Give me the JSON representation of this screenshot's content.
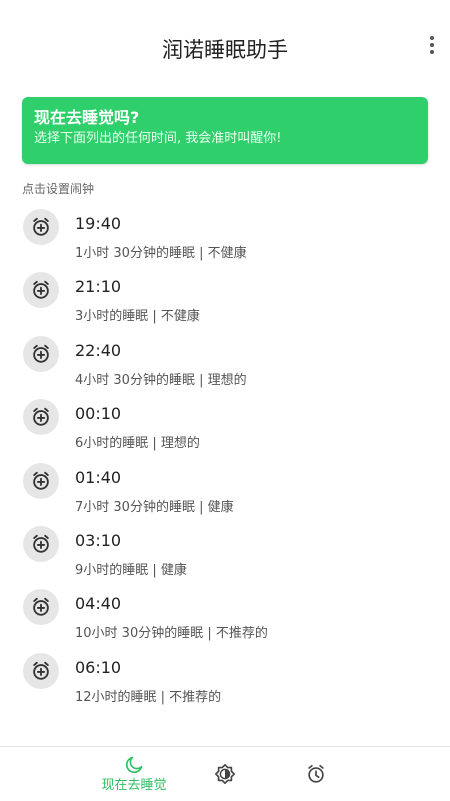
{
  "app": {
    "title": "润诺睡眠助手"
  },
  "banner": {
    "title": "现在去睡觉吗?",
    "subtitle": "选择下面列出的任何时间, 我会准时叫醒你!"
  },
  "section_label": "点击设置闹钟",
  "alarms": [
    {
      "time": "19:40",
      "desc": "1小时 30分钟的睡眠 | 不健康"
    },
    {
      "time": "21:10",
      "desc": "3小时的睡眠 | 不健康"
    },
    {
      "time": "22:40",
      "desc": "4小时 30分钟的睡眠 | 理想的"
    },
    {
      "time": "00:10",
      "desc": "6小时的睡眠 | 理想的"
    },
    {
      "time": "01:40",
      "desc": "7小时 30分钟的睡眠 | 健康"
    },
    {
      "time": "03:10",
      "desc": "9小时的睡眠 | 健康"
    },
    {
      "time": "04:40",
      "desc": "10小时 30分钟的睡眠 | 不推荐的"
    },
    {
      "time": "06:10",
      "desc": "12小时的睡眠 | 不推荐的"
    }
  ],
  "bottom_nav": {
    "sleep_now_label": "现在去睡觉"
  },
  "colors": {
    "accent": "#2fd06b",
    "active_nav": "#2fbf63"
  }
}
